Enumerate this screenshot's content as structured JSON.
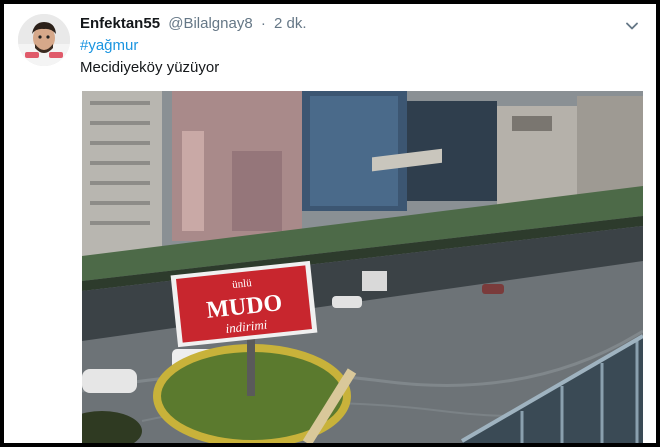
{
  "tweet": {
    "display_name": "Enfektan55",
    "handle": "@Bilalgnay8",
    "separator": "·",
    "timestamp": "2 dk.",
    "hashtag": "#yağmur",
    "text": "Mecidiyeköy yüzüyor"
  },
  "media": {
    "billboard": {
      "top": "ünlü",
      "main": "MUDO",
      "bottom": "indirimi"
    }
  },
  "icons": {
    "menu": "chevron-down-icon",
    "avatar": "avatar"
  },
  "colors": {
    "link": "#1b95e0",
    "secondary_text": "#657786",
    "billboard_red": "#c8262e"
  }
}
